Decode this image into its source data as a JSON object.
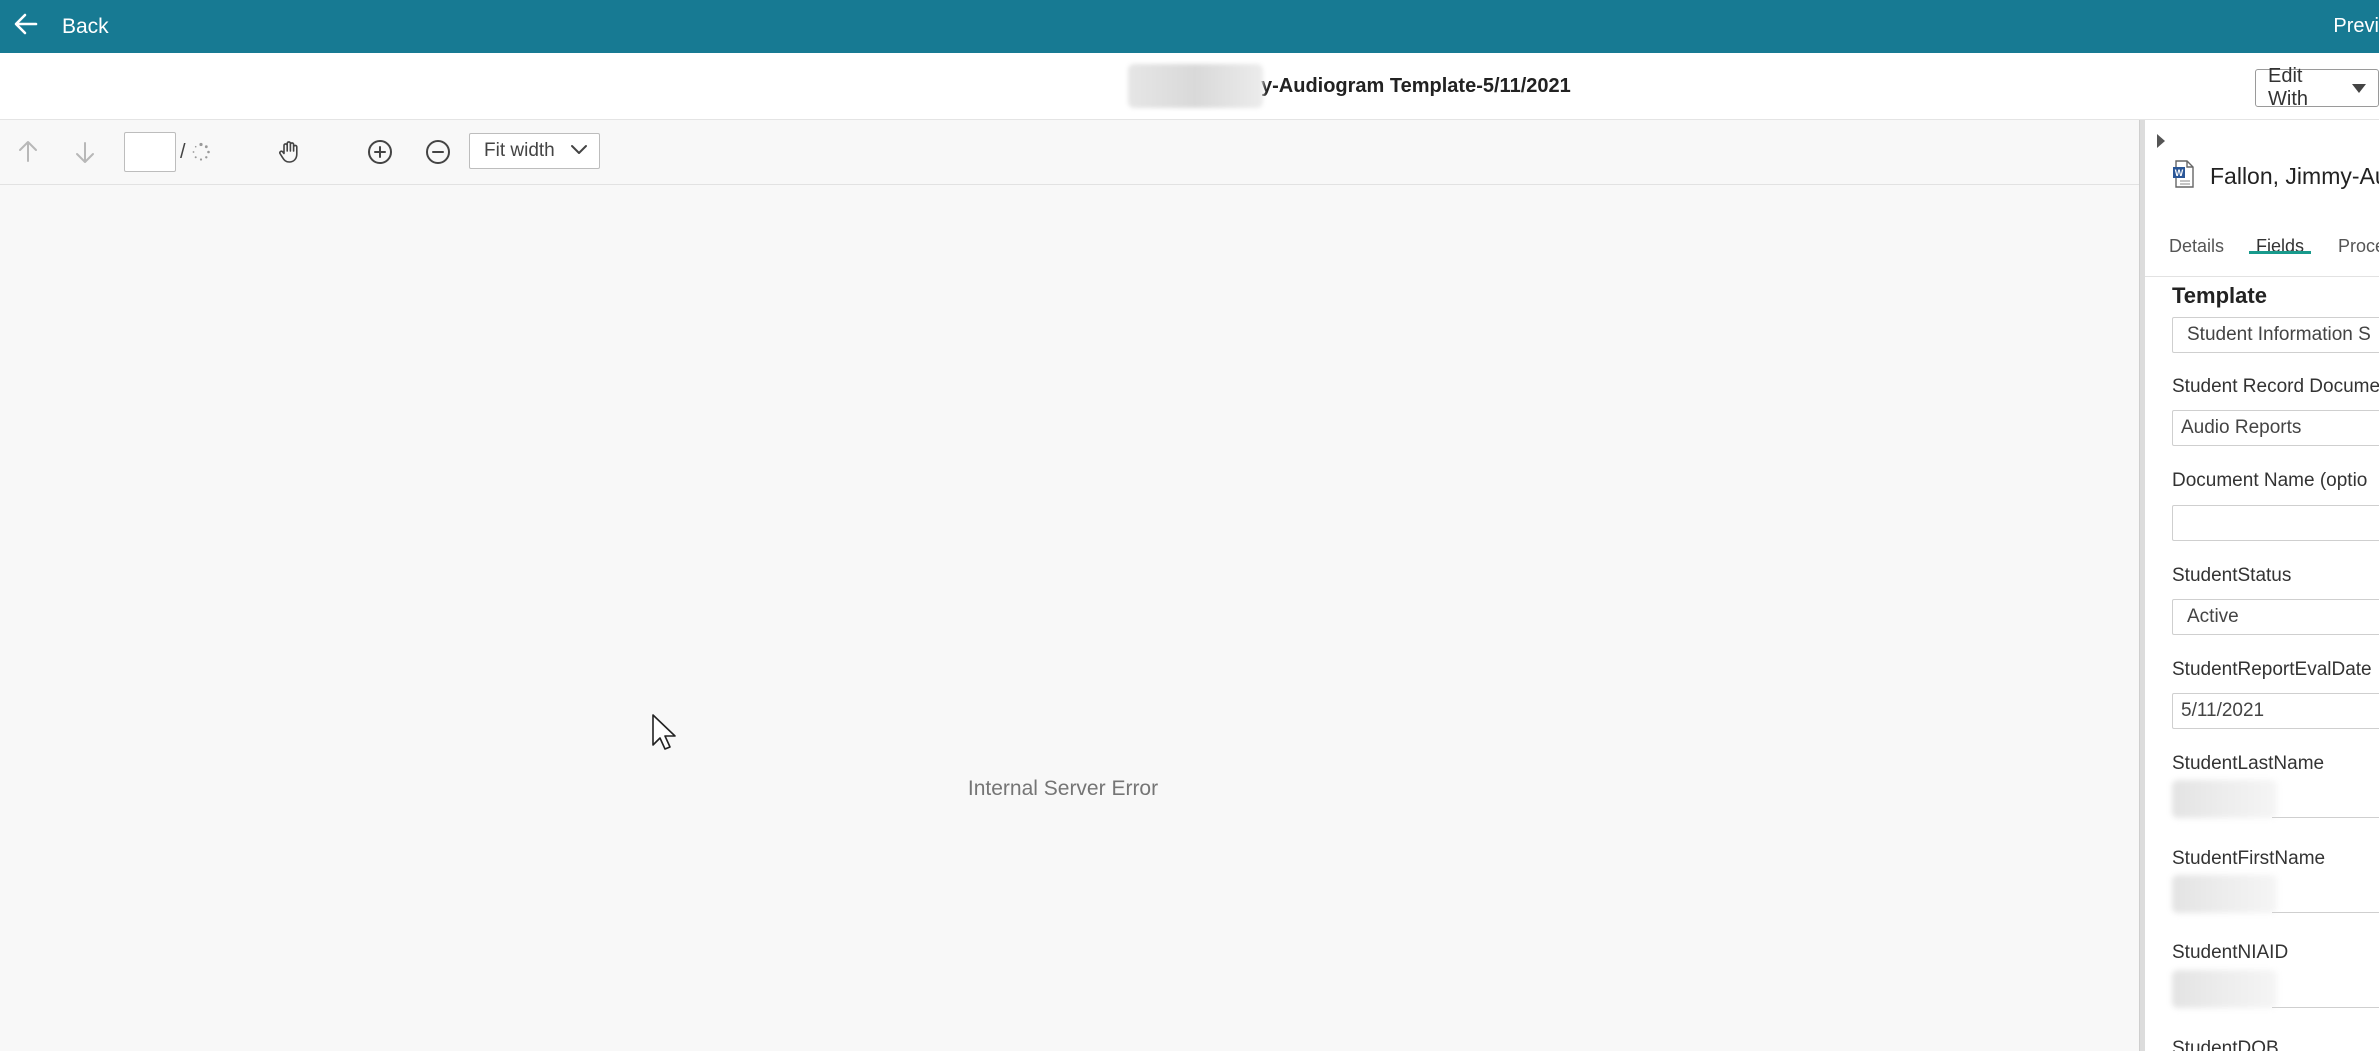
{
  "topbar": {
    "back_label": "Back",
    "right_label": "Previ",
    "accent_color": "#177a93"
  },
  "title": {
    "text": "y-Audiogram Template-5/11/2021",
    "edit_with_label": "Edit With"
  },
  "toolbar": {
    "page_input_value": "",
    "page_separator": "/",
    "zoom_mode": "Fit width",
    "icons": [
      "arrow-up-icon",
      "arrow-down-icon",
      "loading-spinner-icon",
      "hand-pan-icon",
      "zoom-in-icon",
      "zoom-out-icon",
      "chevron-down-icon"
    ]
  },
  "viewer": {
    "message": "Internal Server Error"
  },
  "panel": {
    "file_name": "Fallon, Jimmy-Au",
    "file_icon": "word-document-icon",
    "tabs": [
      {
        "label": "Details",
        "active": false
      },
      {
        "label": "Fields",
        "active": true
      },
      {
        "label": "Proce",
        "active": false
      }
    ],
    "tab_accent": "#189a8c",
    "section_title": "Template",
    "template_value": "Student Information S",
    "fields": [
      {
        "label": "Student Record Docume",
        "value": "Audio Reports"
      },
      {
        "label": "Document Name (optio",
        "value": ""
      },
      {
        "label": "StudentStatus",
        "value": "Active"
      },
      {
        "label": "StudentReportEvalDate",
        "value": "5/11/2021"
      },
      {
        "label": "StudentLastName",
        "value": ""
      },
      {
        "label": "StudentFirstName",
        "value": ""
      },
      {
        "label": "StudentNIAID",
        "value": ""
      },
      {
        "label": "StudentDOB",
        "value": ""
      }
    ]
  }
}
